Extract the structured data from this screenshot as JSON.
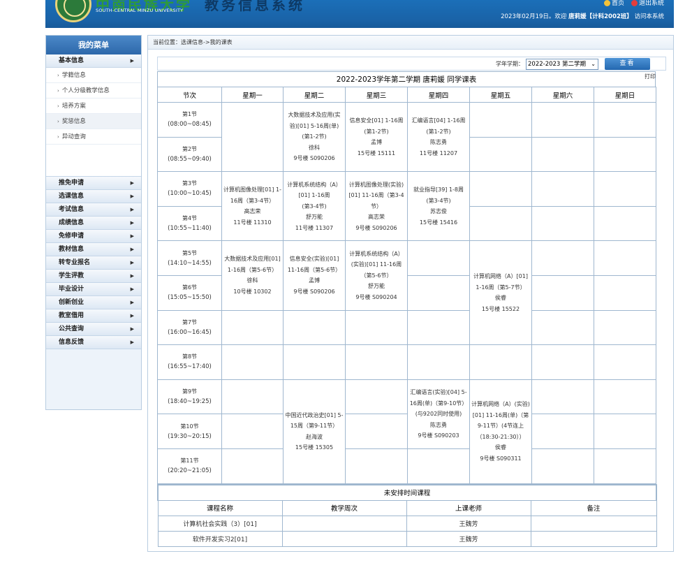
{
  "header": {
    "logo_cn": "中南民族大学",
    "logo_en": "SOUTH-CENTRAL MINZU UNIVERSITY",
    "system_title": "教务信息系统",
    "link_home": "首页",
    "link_logout": "退出系统",
    "date": "2023年02月19日。",
    "welcome": "欢迎",
    "user": "唐莉媛【计科2002班】",
    "visit": "访问本系统"
  },
  "menu": {
    "title": "我的菜单",
    "basic": "基本信息",
    "sub_items": [
      "学籍信息",
      "个人分级教学信息",
      "培养方案",
      "奖惩信息",
      "异动查询"
    ],
    "categories": [
      "推免申请",
      "选课信息",
      "考试信息",
      "成绩信息",
      "免修申请",
      "教材信息",
      "转专业报名",
      "学生评教",
      "毕业设计",
      "创新创业",
      "教室借用",
      "公共查询",
      "信息反馈"
    ]
  },
  "breadcrumb": "当前位置：选课信息->我的课表",
  "term": {
    "label": "学年学期：",
    "selected": "2022-2023 第二学期",
    "button": "查看"
  },
  "schedule": {
    "title": "2022-2023学年第二学期 唐莉媛 同学课表",
    "print": "打印",
    "headers": [
      "节次",
      "星期一",
      "星期二",
      "星期三",
      "星期四",
      "星期五",
      "星期六",
      "星期日"
    ],
    "periods": [
      {
        "name": "第1节",
        "time": "(08:00~08:45)"
      },
      {
        "name": "第2节",
        "time": "(08:55~09:40)"
      },
      {
        "name": "第3节",
        "time": "(10:00~10:45)"
      },
      {
        "name": "第4节",
        "time": "(10:55~11:40)"
      },
      {
        "name": "第5节",
        "time": "(14:10~14:55)"
      },
      {
        "name": "第6节",
        "time": "(15:05~15:50)"
      },
      {
        "name": "第7节",
        "time": "(16:00~16:45)"
      },
      {
        "name": "第8节",
        "time": "(16:55~17:40)"
      },
      {
        "name": "第9节",
        "time": "(18:40~19:25)"
      },
      {
        "name": "第10节",
        "time": "(19:30~20:15)"
      },
      {
        "name": "第11节",
        "time": "(20:20~21:05)"
      }
    ],
    "courses": {
      "tue_12": [
        "大数据技术及应用(实验)[01] 5-16周(单)",
        "(第1-2节)",
        "徐科",
        "9号楼 S090206"
      ],
      "wed_12": [
        "信息安全[01] 1-16周",
        "(第1-2节)",
        "孟博",
        "15号楼 15111"
      ],
      "thu_12": [
        "汇编语言[04] 1-16周",
        "(第1-2节)",
        "陈志勇",
        "11号楼 11207"
      ],
      "mon_34": [
        "计算机图像处理[01] 1-16周（第3-4节）",
        "高志荣",
        "11号楼 11310"
      ],
      "tue_34": [
        "计算机系统结构（A）[01] 1-16周",
        "(第3-4节)",
        "舒万能",
        "11号楼 11307"
      ],
      "wed_34": [
        "计算机图像处理(实验)[01] 11-16周（第3-4节）",
        "高志荣",
        "9号楼 S090206"
      ],
      "thu_34": [
        "就业指导[39] 1-8周",
        "(第3-4节)",
        "苏志俊",
        "15号楼 15416"
      ],
      "mon_56": [
        "大数据技术及应用[01] 1-16周（第5-6节）",
        "徐科",
        "10号楼 10302"
      ],
      "tue_56": [
        "信息安全(实验)[01] 11-16周（第5-6节）",
        "孟博",
        "9号楼 S090206"
      ],
      "wed_56": [
        "计算机系统结构（A）(实验)[01] 11-16周（第5-6节）",
        "舒万能",
        "9号楼 S090204"
      ],
      "fri_57": [
        "计算机网络（A）[01] 1-16周（第5-7节）",
        "侯睿",
        "15号楼 15522"
      ],
      "tue_911": [
        "中国近代政治史[01] 5-15周（第9-11节）",
        "赵海波",
        "15号楼 15305"
      ],
      "thu_910": [
        "汇编语言(实验)[04] 5-16周(单)（第9-10节）(与9202同时使用)",
        "陈志勇",
        "9号楼 S090203"
      ],
      "fri_911": [
        "计算机网络（A）(实验)[01] 11-16周(单)（第9-11节）(4节连上（18:30-21:30））",
        "侯睿",
        "9号楼 S090311"
      ]
    }
  },
  "unscheduled": {
    "caption": "未安排时间课程",
    "headers": [
      "课程名称",
      "教学周次",
      "上课老师",
      "备注"
    ],
    "rows": [
      {
        "name": "计算机社会实践（3）[01]",
        "weeks": "",
        "teacher": "王魏芳",
        "note": ""
      },
      {
        "name": "软件开发实习2[01]",
        "weeks": "",
        "teacher": "王魏芳",
        "note": ""
      }
    ]
  }
}
